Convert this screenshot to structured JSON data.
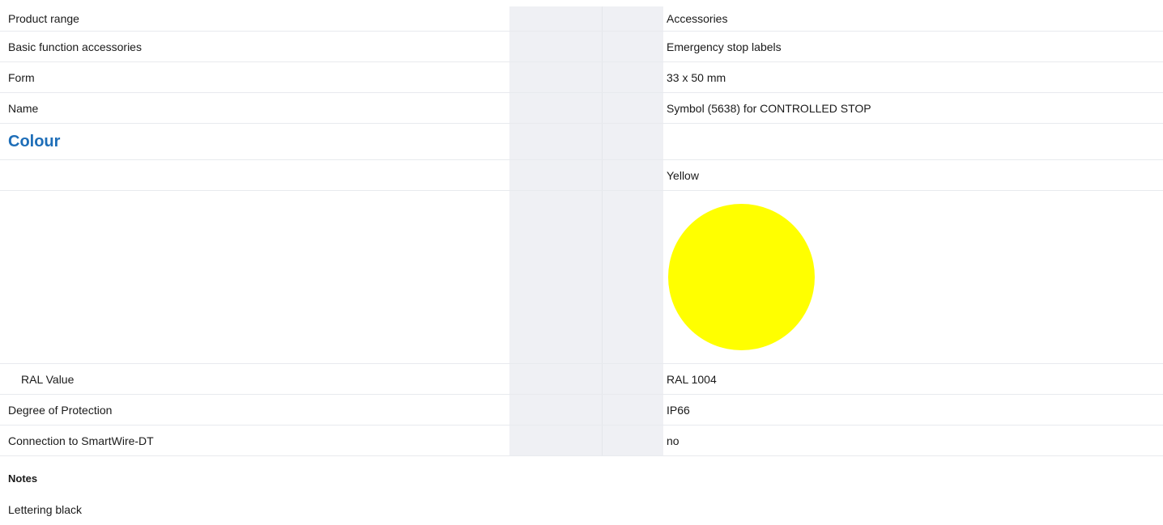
{
  "rows": [
    {
      "label": "Product range",
      "value": "Accessories"
    },
    {
      "label": "Basic function accessories",
      "value": "Emergency stop labels"
    },
    {
      "label": "Form",
      "value": "33 x 50 mm"
    },
    {
      "label": "Name",
      "value": "Symbol (5638) for CONTROLLED STOP"
    }
  ],
  "colour_section": {
    "title": "Colour",
    "colour_name": "Yellow",
    "swatch_color": "#FFFF00",
    "ral_label": "RAL Value",
    "ral_value": "RAL 1004"
  },
  "rows2": [
    {
      "label": "Degree of Protection",
      "value": "IP66"
    },
    {
      "label": "Connection to SmartWire-DT",
      "value": "no"
    }
  ],
  "notes": {
    "title": "Notes",
    "text": "Lettering black"
  },
  "accent_color": "#1E6EB8"
}
